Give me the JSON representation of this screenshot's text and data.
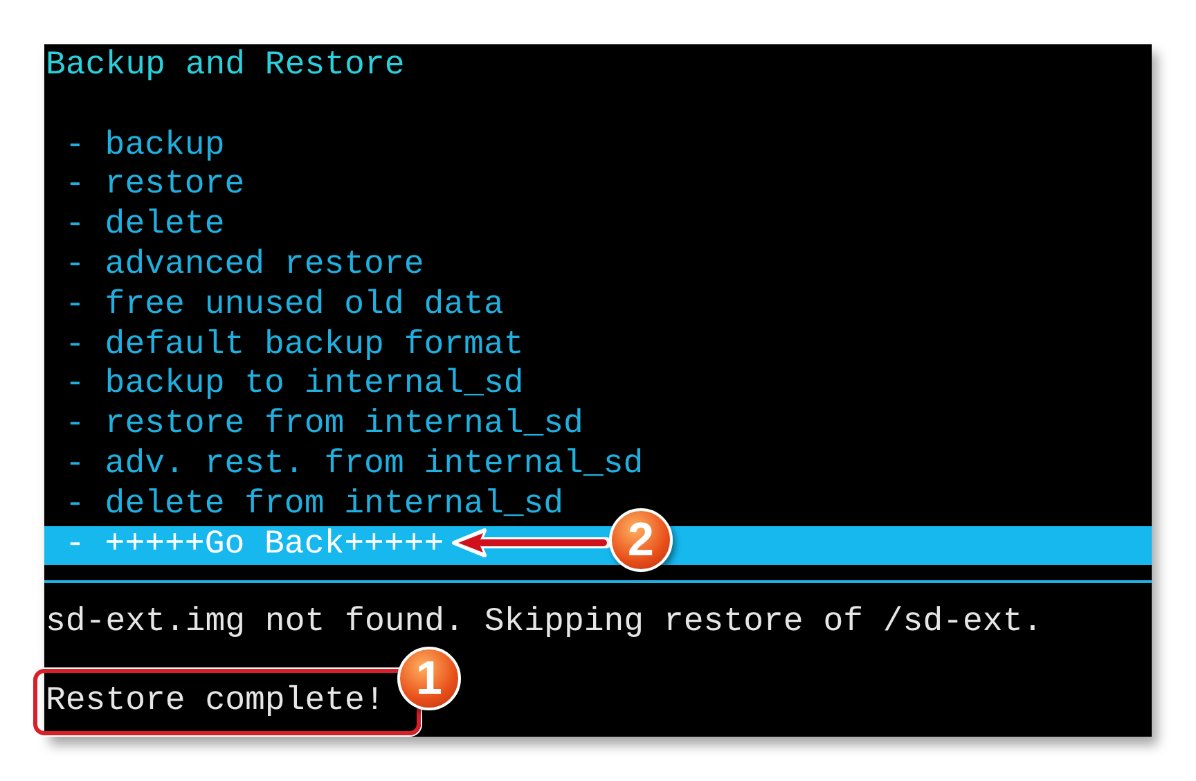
{
  "screen": {
    "title": "Backup and Restore",
    "menu_items": [
      {
        "label": "- backup",
        "selected": false
      },
      {
        "label": "- restore",
        "selected": false
      },
      {
        "label": "- delete",
        "selected": false
      },
      {
        "label": "- advanced restore",
        "selected": false
      },
      {
        "label": "- free unused old data",
        "selected": false
      },
      {
        "label": "- default backup format",
        "selected": false
      },
      {
        "label": "- backup to internal_sd",
        "selected": false
      },
      {
        "label": "- restore from internal_sd",
        "selected": false
      },
      {
        "label": "- adv. rest. from internal_sd",
        "selected": false
      },
      {
        "label": "- delete from internal_sd",
        "selected": false
      },
      {
        "label": "- +++++Go Back+++++",
        "selected": true
      }
    ],
    "log_lines": [
      {
        "text": "sd-ext.img not found. Skipping restore of /sd-ext.",
        "framed": false
      },
      {
        "text": "Restore complete!",
        "framed": true
      }
    ]
  },
  "annotations": [
    {
      "number": "1"
    },
    {
      "number": "2"
    }
  ]
}
